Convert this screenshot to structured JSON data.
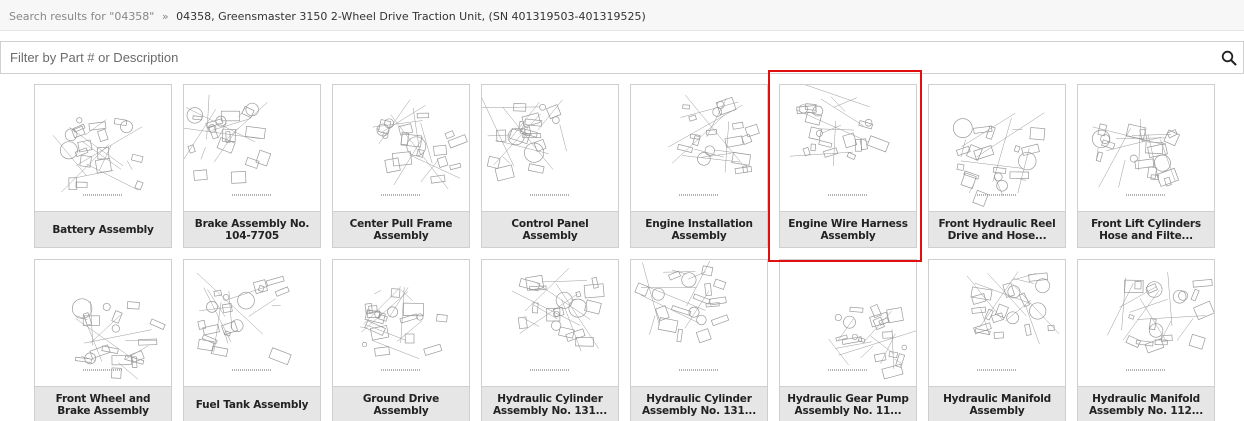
{
  "breadcrumb": {
    "search_link": "Search results for \"04358\"",
    "separator": "»",
    "current": "04358, Greensmaster 3150 2-Wheel Drive Traction Unit, (SN 401319503-401319525)"
  },
  "filter": {
    "placeholder": "Filter by Part # or Description",
    "value": "",
    "search_icon": "magnifier-icon"
  },
  "assemblies": [
    {
      "label": "Battery Assembly"
    },
    {
      "label": "Brake Assembly No. 104-7705"
    },
    {
      "label": "Center Pull Frame Assembly"
    },
    {
      "label": "Control Panel Assembly"
    },
    {
      "label": "Engine Installation Assembly"
    },
    {
      "label": "Engine Wire Harness Assembly"
    },
    {
      "label": "Front Hydraulic Reel Drive and Hose..."
    },
    {
      "label": "Front Lift Cylinders Hose and Filte..."
    },
    {
      "label": "Front Wheel and Brake Assembly"
    },
    {
      "label": "Fuel Tank Assembly"
    },
    {
      "label": "Ground Drive Assembly"
    },
    {
      "label": "Hydraulic Cylinder Assembly No. 131..."
    },
    {
      "label": "Hydraulic Cylinder Assembly No. 131..."
    },
    {
      "label": "Hydraulic Gear Pump Assembly No. 11..."
    },
    {
      "label": "Hydraulic Manifold Assembly"
    },
    {
      "label": "Hydraulic Manifold Assembly No. 112..."
    }
  ],
  "highlighted_item": "Engine Wire Harness Assembly",
  "colors": {
    "highlight": "#e01010",
    "label_bg": "#e6e6e6",
    "card_border": "#cfcfcf"
  }
}
